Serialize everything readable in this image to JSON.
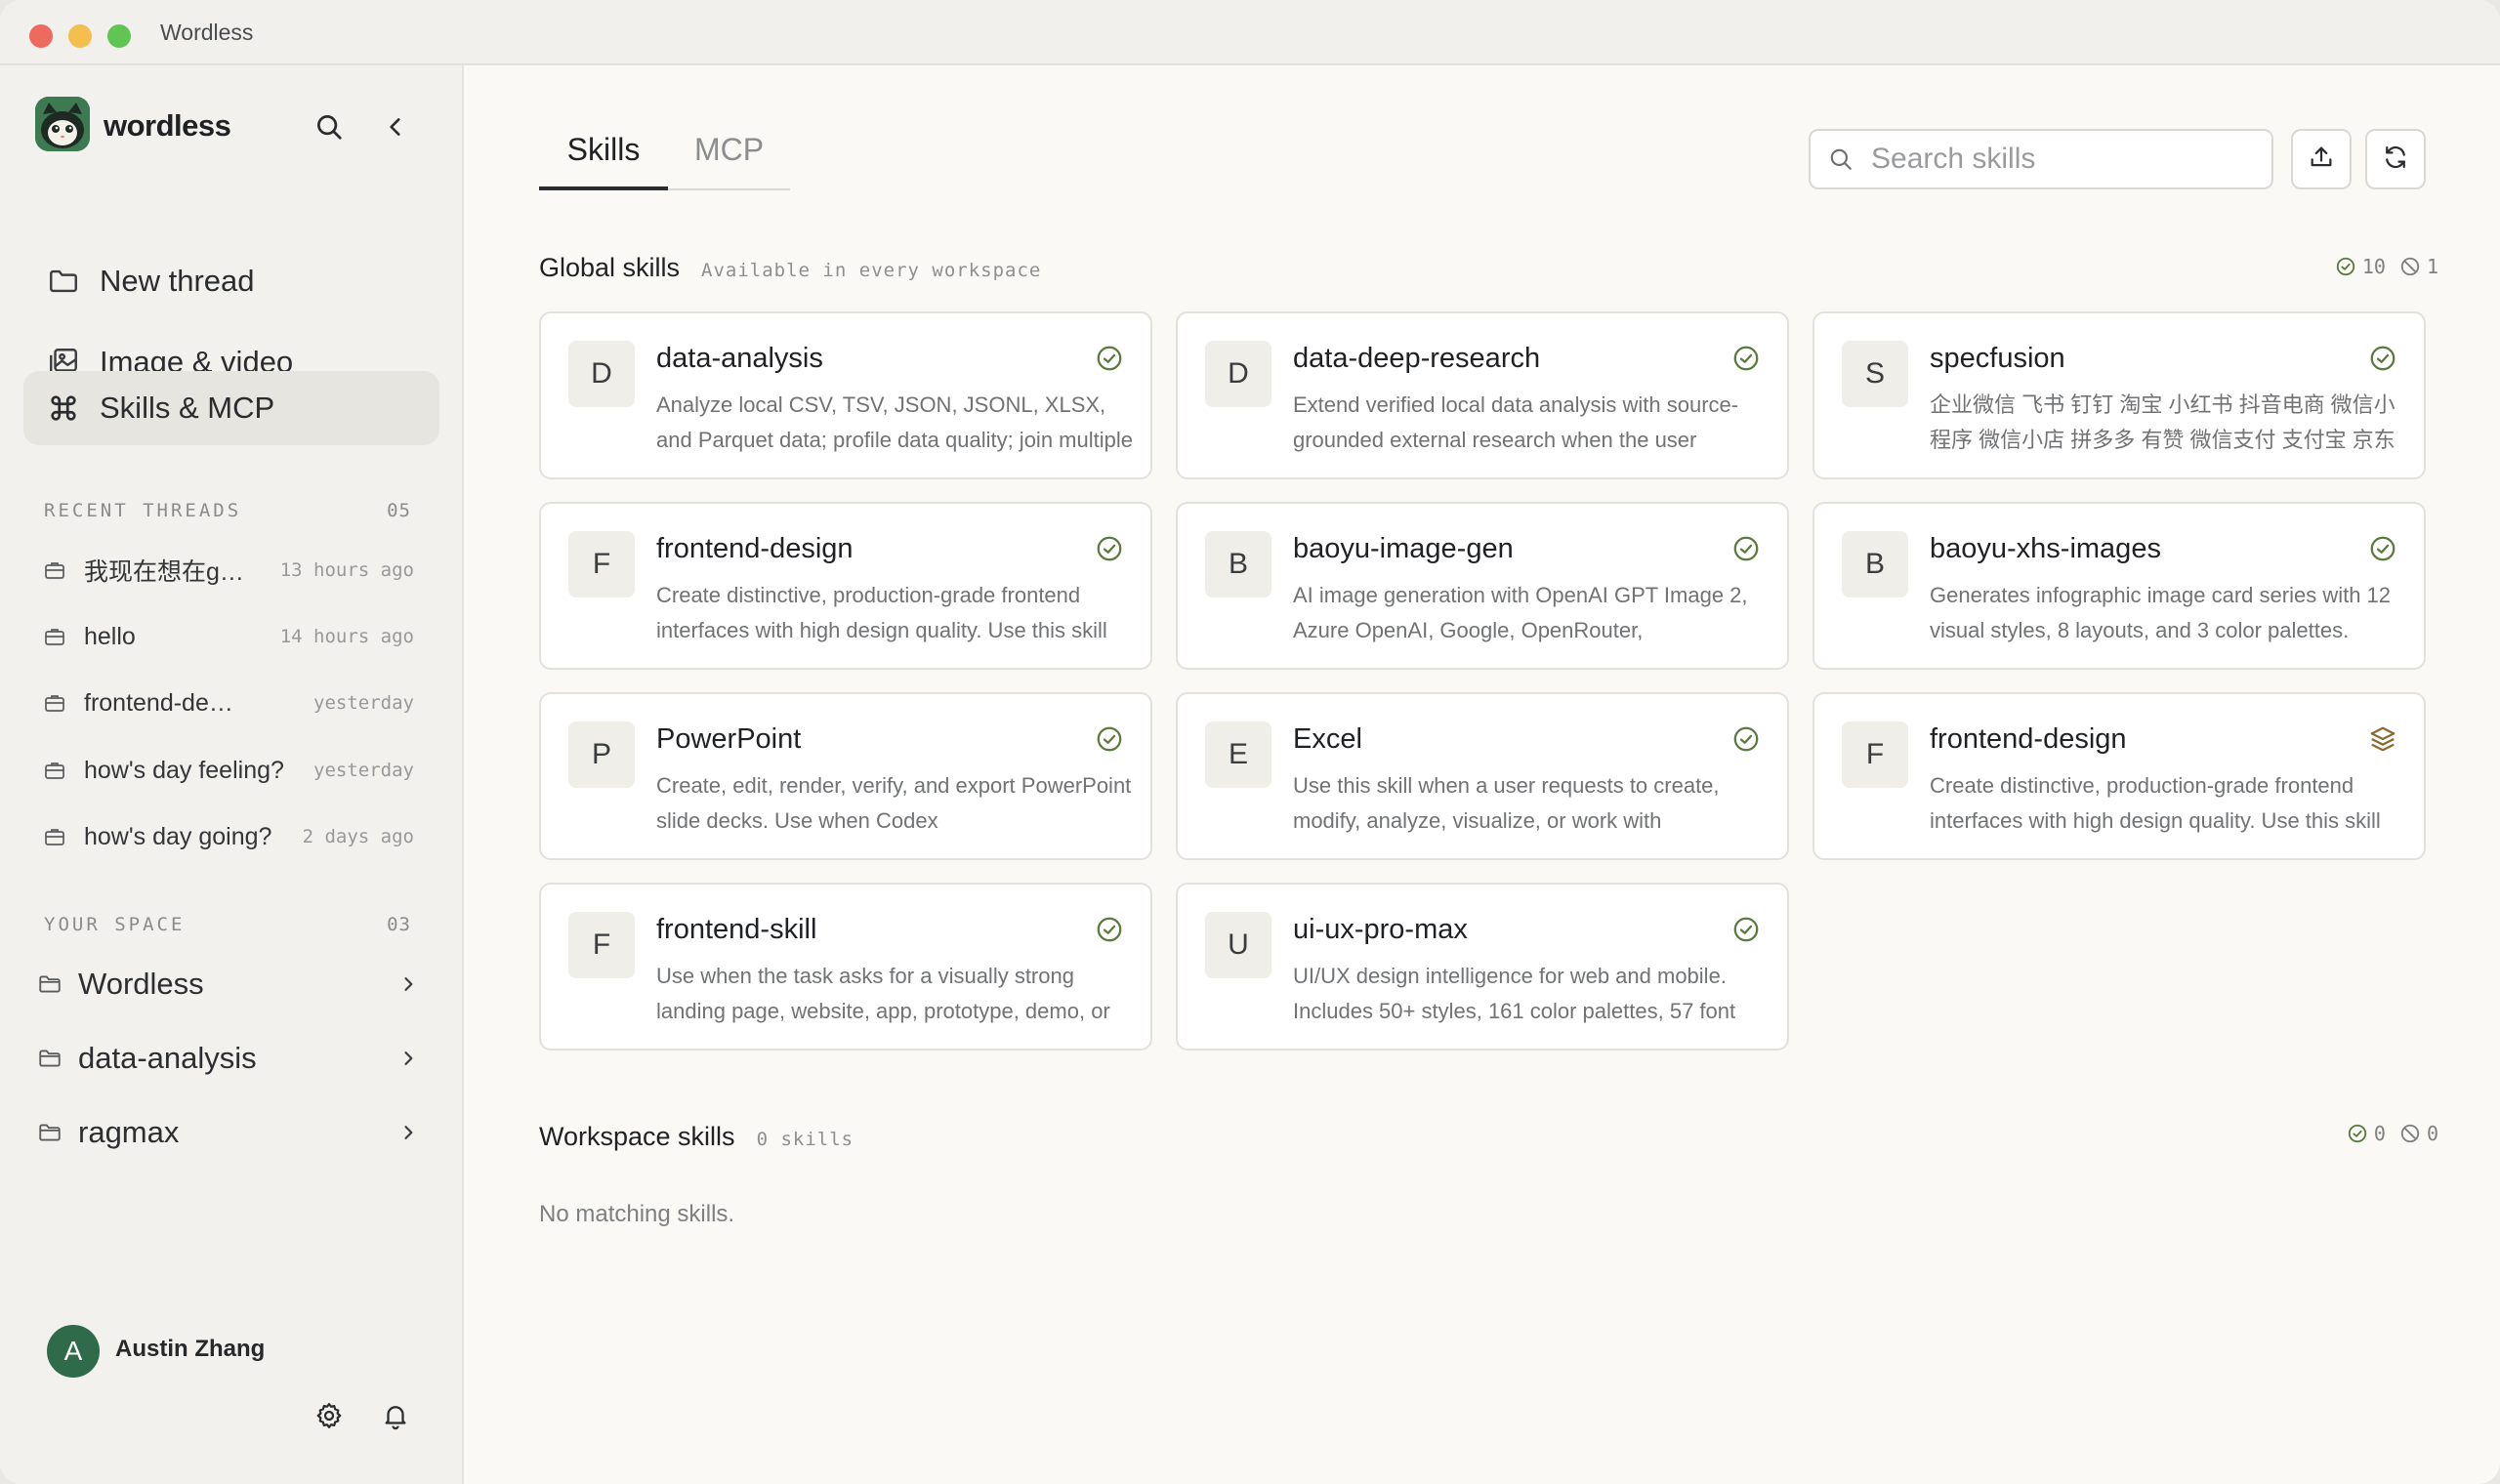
{
  "window": {
    "title": "Wordless"
  },
  "sidebar": {
    "brand": "wordless",
    "nav": [
      {
        "label": "New thread",
        "icon": "folder-icon"
      },
      {
        "label": "Image & video",
        "icon": "image-gallery-icon"
      },
      {
        "label": "Skills & MCP",
        "icon": "command-icon",
        "active": true
      }
    ],
    "recent_threads": {
      "title": "RECENT THREADS",
      "count": "05",
      "items": [
        {
          "label": "我现在想在git...",
          "time": "13 hours ago"
        },
        {
          "label": "hello",
          "time": "14 hours ago"
        },
        {
          "label": "frontend-design ...",
          "time": "yesterday"
        },
        {
          "label": "how's day feeling?",
          "time": "yesterday"
        },
        {
          "label": "how's day going?",
          "time": "2 days ago"
        }
      ]
    },
    "your_space": {
      "title": "YOUR SPACE",
      "count": "03",
      "items": [
        {
          "label": "Wordless"
        },
        {
          "label": "data-analysis"
        },
        {
          "label": "ragmax"
        }
      ]
    },
    "user": {
      "initial": "A",
      "name": "Austin Zhang"
    }
  },
  "main": {
    "tabs": [
      {
        "label": "Skills",
        "active": true
      },
      {
        "label": "MCP"
      }
    ],
    "search": {
      "placeholder": "Search skills",
      "value": ""
    },
    "global": {
      "title": "Global skills",
      "subtitle": "Available in every workspace",
      "enabled_count": "10",
      "disabled_count": "1",
      "cards": [
        {
          "letter": "D",
          "title": "data-analysis",
          "desc": "Analyze local CSV, TSV, JSON, JSONL, XLSX, and Parquet data; profile data quality; join multiple",
          "status": "enabled"
        },
        {
          "letter": "D",
          "title": "data-deep-research",
          "desc": "Extend verified local data analysis with source-grounded external research when the user",
          "status": "enabled"
        },
        {
          "letter": "S",
          "title": "specfusion",
          "desc": "企业微信 飞书 钉钉 淘宝 小红书 抖音电商 微信小程序 微信小店 拼多多 有赞 微信支付 支付宝 京东",
          "status": "enabled"
        },
        {
          "letter": "F",
          "title": "frontend-design",
          "desc": "Create distinctive, production-grade frontend interfaces with high design quality. Use this skill",
          "status": "enabled"
        },
        {
          "letter": "B",
          "title": "baoyu-image-gen",
          "desc": "AI image generation with OpenAI GPT Image 2, Azure OpenAI, Google, OpenRouter,",
          "status": "enabled"
        },
        {
          "letter": "B",
          "title": "baoyu-xhs-images",
          "desc": "Generates infographic image card series with 12 visual styles, 8 layouts, and 3 color palettes.",
          "status": "enabled"
        },
        {
          "letter": "P",
          "title": "PowerPoint",
          "desc": "Create, edit, render, verify, and export PowerPoint slide decks. Use when Codex",
          "status": "enabled"
        },
        {
          "letter": "E",
          "title": "Excel",
          "desc": "Use this skill when a user requests to create, modify, analyze, visualize, or work with",
          "status": "enabled"
        },
        {
          "letter": "F",
          "title": "frontend-design",
          "desc": "Create distinctive, production-grade frontend interfaces with high design quality. Use this skill",
          "status": "layered"
        },
        {
          "letter": "F",
          "title": "frontend-skill",
          "desc": "Use when the task asks for a visually strong landing page, website, app, prototype, demo, or",
          "status": "enabled"
        },
        {
          "letter": "U",
          "title": "ui-ux-pro-max",
          "desc": "UI/UX design intelligence for web and mobile. Includes 50+ styles, 161 color palettes, 57 font",
          "status": "enabled"
        }
      ]
    },
    "workspace": {
      "title": "Workspace skills",
      "subtitle": "0 skills",
      "enabled_count": "0",
      "disabled_count": "0",
      "empty": "No matching skills."
    }
  },
  "colors": {
    "accent_green": "#5b7a3e",
    "avatar_green": "#2f6b4a",
    "layer_gold": "#8a6a2e"
  }
}
